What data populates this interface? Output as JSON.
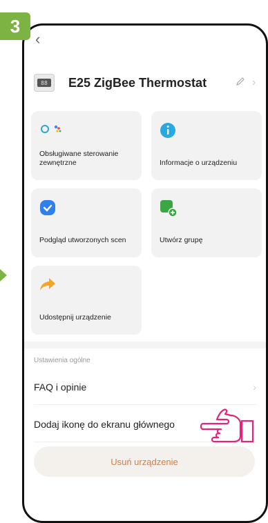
{
  "step": "3",
  "device": {
    "title": "E25 ZigBee Thermostat",
    "thumb_text": "88"
  },
  "tiles": [
    {
      "label": "Obsługiwane sterowanie zewnętrzne"
    },
    {
      "label": "Informacje o urządzeniu"
    },
    {
      "label": "Podgląd utworzonych scen"
    },
    {
      "label": "Utwórz grupę"
    },
    {
      "label": "Udostępnij urządzenie"
    }
  ],
  "section": {
    "title": "Ustawienia ogólne"
  },
  "rows": [
    {
      "label": "FAQ i opinie"
    },
    {
      "label": "Dodaj ikonę do ekranu głównego"
    }
  ],
  "delete_label": "Usuń urządzenie",
  "colors": {
    "badge": "#7cb342",
    "accent_orange": "#e07a3c",
    "hand": "#e6227a"
  }
}
